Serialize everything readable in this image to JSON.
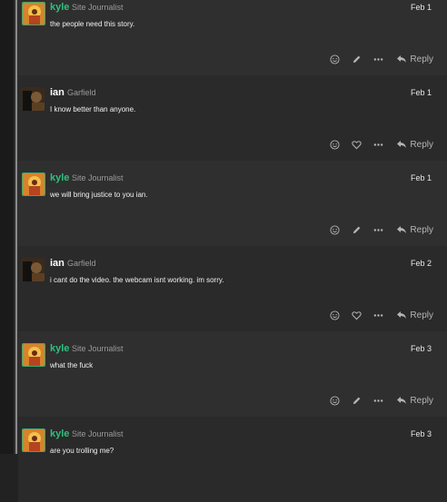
{
  "posts": [
    {
      "username": "kyle",
      "title": "Site Journalist",
      "date": "Feb 1",
      "body": "the people need this story.",
      "actions": [
        "smile-icon",
        "pencil-icon",
        "more-icon"
      ],
      "reply_label": "Reply"
    },
    {
      "username": "ian",
      "title": "Garfield",
      "date": "Feb 1",
      "body": "I know better than anyone.",
      "actions": [
        "smile-icon",
        "heart-icon",
        "more-icon"
      ],
      "reply_label": "Reply"
    },
    {
      "username": "kyle",
      "title": "Site Journalist",
      "date": "Feb 1",
      "body": "we will bring justice to you ian.",
      "actions": [
        "smile-icon",
        "pencil-icon",
        "more-icon"
      ],
      "reply_label": "Reply"
    },
    {
      "username": "ian",
      "title": "Garfield",
      "date": "Feb 2",
      "body": "i cant do the video. the webcam isnt working. im sorry.",
      "actions": [
        "smile-icon",
        "heart-icon",
        "more-icon"
      ],
      "reply_label": "Reply"
    },
    {
      "username": "kyle",
      "title": "Site Journalist",
      "date": "Feb 3",
      "body": "what the fuck",
      "actions": [
        "smile-icon",
        "pencil-icon",
        "more-icon"
      ],
      "reply_label": "Reply"
    },
    {
      "username": "kyle",
      "title": "Site Journalist",
      "date": "Feb 3",
      "body": "are you trolling me?",
      "actions": [],
      "reply_label": ""
    }
  ],
  "colors": {
    "kyle_name": "#2fbf7f",
    "ian_name": "#ffffff",
    "rail": "#8a8a8a"
  }
}
